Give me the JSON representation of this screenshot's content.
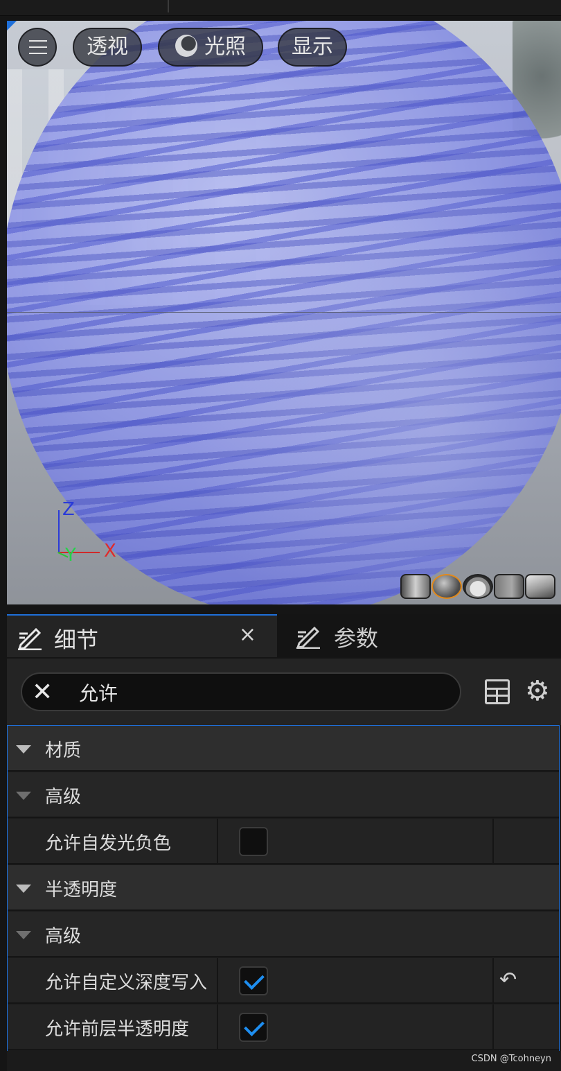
{
  "viewport": {
    "buttons": {
      "persp_label": "透视",
      "lighting_label": "光照",
      "show_label": "显示"
    },
    "axis": {
      "z": "Z",
      "x": "X",
      "y": "Y"
    },
    "preview_shapes": [
      "cylinder-icon",
      "sphere-icon",
      "plane-icon",
      "cube-icon",
      "teapot-icon"
    ],
    "selected_shape": "sphere-icon"
  },
  "tabs": [
    {
      "label": "细节",
      "active": true,
      "close": "×"
    },
    {
      "label": "参数",
      "active": false
    }
  ],
  "search": {
    "value": "允许",
    "clear": "✕"
  },
  "details": {
    "rows": [
      {
        "type": "category",
        "label": "材质"
      },
      {
        "type": "subcategory",
        "label": "高级"
      },
      {
        "type": "property",
        "label": "允许自发光负色",
        "checked": false
      },
      {
        "type": "category",
        "label": "半透明度"
      },
      {
        "type": "subcategory",
        "label": "高级"
      },
      {
        "type": "property",
        "label": "允许自定义深度写入",
        "checked": true,
        "reset": "↶"
      },
      {
        "type": "property",
        "label": "允许前层半透明度",
        "checked": true
      }
    ]
  },
  "watermark": "CSDN @Tcohneyn",
  "colors": {
    "accent": "#1e6fd9",
    "check": "#1e8ef0",
    "axis_x": "#e02a2a",
    "axis_y": "#24d34a",
    "axis_z": "#2a3bd8"
  }
}
